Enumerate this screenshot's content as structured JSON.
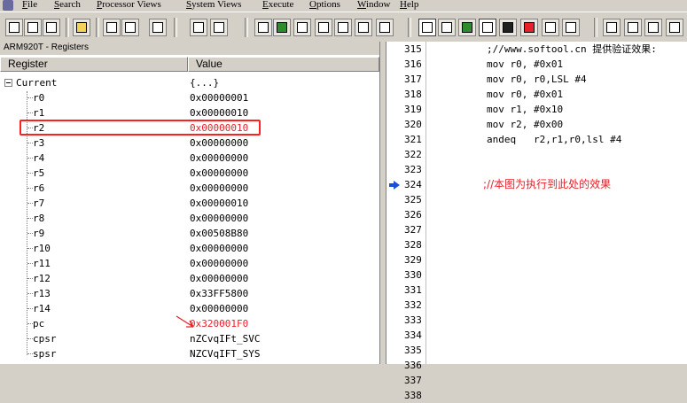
{
  "menubar": {
    "items": [
      "File",
      "Search",
      "Processor Views",
      "System Views",
      "Execute",
      "Options",
      "Window",
      "Help"
    ]
  },
  "toolbar": {
    "buttons": [
      "open-project-icon",
      "reload-icon",
      "open-file-icon",
      "download-icon",
      "save-icon",
      "paste-icon",
      "find-icon",
      "find-next-icon",
      "view-registers-icon",
      "view-watch-icon",
      "view-variables-icon",
      "view-memory-icon",
      "view-disassembly-icon",
      "view-search-icon",
      "view-source-icon",
      "view-registers-active-icon",
      "view-locals-icon",
      "view-console-icon",
      "view-breakpoints-icon",
      "view-watch-window-icon",
      "step-in-icon",
      "step-over-icon",
      "step-out-icon",
      "run-to-cursor-icon"
    ]
  },
  "registers": {
    "title": "ARM920T - Registers",
    "col_register": "Register",
    "col_value": "Value",
    "root_label": "Current",
    "root_value": "{...}",
    "rows": [
      {
        "name": "r0",
        "value": "0x00000001"
      },
      {
        "name": "r1",
        "value": "0x00000010"
      },
      {
        "name": "r2",
        "value": "0x00000010"
      },
      {
        "name": "r3",
        "value": "0x00000000"
      },
      {
        "name": "r4",
        "value": "0x00000000"
      },
      {
        "name": "r5",
        "value": "0x00000000"
      },
      {
        "name": "r6",
        "value": "0x00000000"
      },
      {
        "name": "r7",
        "value": "0x00000010"
      },
      {
        "name": "r8",
        "value": "0x00000000"
      },
      {
        "name": "r9",
        "value": "0x00508B80"
      },
      {
        "name": "r10",
        "value": "0x00000000"
      },
      {
        "name": "r11",
        "value": "0x00000000"
      },
      {
        "name": "r12",
        "value": "0x00000000"
      },
      {
        "name": "r13",
        "value": "0x33FF5800"
      },
      {
        "name": "r14",
        "value": "0x00000000"
      },
      {
        "name": "pc",
        "value": "0x320001F0"
      },
      {
        "name": "cpsr",
        "value": "nZCvqIFt_SVC"
      },
      {
        "name": "spsr",
        "value": "NZCVqIFT_SYS"
      }
    ],
    "highlighted_row": "r2",
    "colors": {
      "highlight": "#e8202a"
    }
  },
  "source": {
    "lines": [
      {
        "num": "315",
        "text": ";//www.softool.cn 提供验证效果:"
      },
      {
        "num": "316",
        "text": "mov r0, #0x01"
      },
      {
        "num": "317",
        "text": "mov r0, r0,LSL #4"
      },
      {
        "num": "318",
        "text": "mov r0, #0x01"
      },
      {
        "num": "319",
        "text": "mov r1, #0x10"
      },
      {
        "num": "320",
        "text": "mov r2, #0x00"
      },
      {
        "num": "321",
        "text": "andeq   r2,r1,r0,lsl #4"
      },
      {
        "num": "322",
        "text": ""
      },
      {
        "num": "323",
        "text": ""
      },
      {
        "num": "324",
        "text": ";//本图为执行到此处的效果"
      },
      {
        "num": "325",
        "text": ""
      },
      {
        "num": "326",
        "text": ""
      },
      {
        "num": "327",
        "text": ""
      },
      {
        "num": "328",
        "text": ""
      },
      {
        "num": "329",
        "text": ""
      },
      {
        "num": "330",
        "text": ""
      },
      {
        "num": "331",
        "text": ""
      },
      {
        "num": "332",
        "text": ""
      },
      {
        "num": "333",
        "text": ""
      },
      {
        "num": "334",
        "text": ""
      },
      {
        "num": "335",
        "text": ""
      },
      {
        "num": "336",
        "text": ""
      },
      {
        "num": "337",
        "text": ""
      },
      {
        "num": "338",
        "text": ""
      }
    ],
    "current_line": "324",
    "colors": {
      "annotation": "#e8202a",
      "current_marker": "#1b4fd8"
    }
  }
}
